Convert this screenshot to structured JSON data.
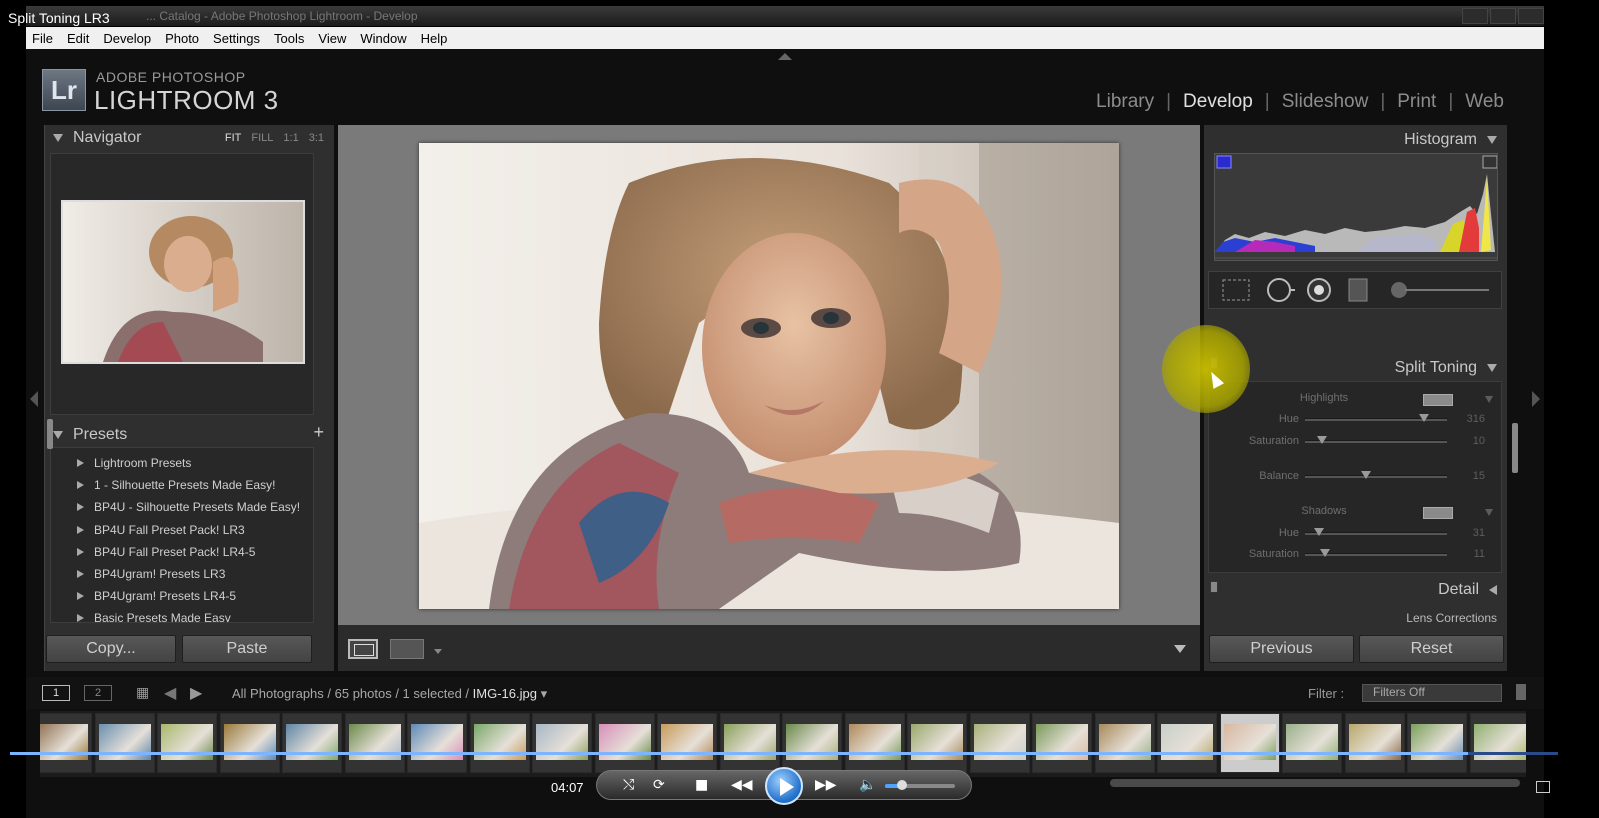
{
  "video": {
    "title": "Split Toning LR3",
    "time": "04:07",
    "progress_fraction": 0.942
  },
  "window": {
    "title": "... Catalog - Adobe Photoshop Lightroom - Develop"
  },
  "menubar": [
    "File",
    "Edit",
    "Develop",
    "Photo",
    "Settings",
    "Tools",
    "View",
    "Window",
    "Help"
  ],
  "identity": {
    "logo": "Lr",
    "adobe": "ADOBE PHOTOSHOP",
    "product": "LIGHTROOM 3"
  },
  "modules": [
    {
      "label": "Library",
      "active": false
    },
    {
      "label": "Develop",
      "active": true
    },
    {
      "label": "Slideshow",
      "active": false
    },
    {
      "label": "Print",
      "active": false
    },
    {
      "label": "Web",
      "active": false
    }
  ],
  "navigator": {
    "title": "Navigator",
    "zoom_options": [
      "FIT",
      "FILL",
      "1:1",
      "3:1"
    ],
    "active_zoom": "FIT"
  },
  "presets": {
    "title": "Presets",
    "add_label": "+",
    "items": [
      "Lightroom Presets",
      "1 - Silhouette Presets Made Easy!",
      "BP4U - Silhouette Presets Made Easy!",
      "BP4U Fall Preset Pack! LR3",
      "BP4U Fall Preset Pack! LR4-5",
      "BP4Ugram! Presets LR3",
      "BP4Ugram! Presets LR4-5",
      "Basic Presets Made Easy"
    ]
  },
  "left_buttons": {
    "copy": "Copy...",
    "paste": "Paste"
  },
  "right_panel": {
    "histogram_title": "Histogram",
    "split_toning_title": "Split Toning",
    "highlights": {
      "label": "Highlights",
      "hue_label": "Hue",
      "hue_value": "316",
      "saturation_label": "Saturation",
      "saturation_value": "10",
      "hue_fraction": 0.84,
      "saturation_fraction": 0.12
    },
    "balance": {
      "label": "Balance",
      "value": "15",
      "fraction": 0.43
    },
    "shadows": {
      "label": "Shadows",
      "hue_label": "Hue",
      "hue_value": "31",
      "saturation_label": "Saturation",
      "saturation_value": "11",
      "hue_fraction": 0.1,
      "saturation_fraction": 0.14
    },
    "detail_title": "Detail",
    "lens_title": "Lens Corrections"
  },
  "right_buttons": {
    "previous": "Previous",
    "reset": "Reset"
  },
  "filmstrip": {
    "page1": "1",
    "page2": "2",
    "source": "All Photographs / 65 photos / 1 selected / ",
    "filename": "IMG-16.jpg",
    "filter_label": "Filter :",
    "filter_value": "Filters Off",
    "selected_index": 19
  },
  "colors": {
    "panel": "#2f2f2f",
    "background": "#7a7a7a",
    "highlight_cursor": "#c8be00",
    "video_progress": "#7cb4ff"
  }
}
